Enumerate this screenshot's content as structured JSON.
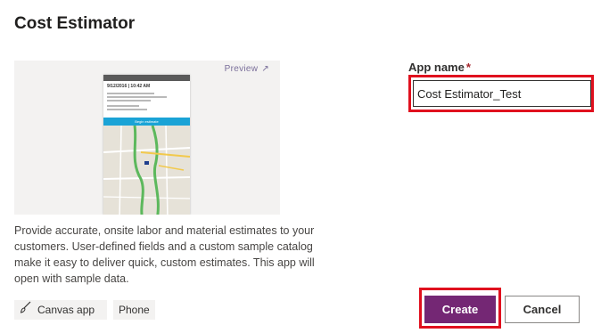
{
  "dialog": {
    "title": "Cost Estimator"
  },
  "preview": {
    "link_label": "Preview",
    "link_icon": "external-link-icon",
    "phone": {
      "date_text": "9/12/2016 | 10:42 AM",
      "button_text": "Begin estimate"
    }
  },
  "description": "Provide accurate, onsite labor and material estimates to your customers. User-defined fields and a custom sample catalog make it easy to deliver quick, custom estimates. This app will open with sample data.",
  "tags": [
    {
      "label": "Canvas app",
      "icon": "paintbrush-icon"
    },
    {
      "label": "Phone"
    }
  ],
  "form": {
    "app_name_label": "App name",
    "required_marker": "*",
    "app_name_value": "Cost Estimator_Test"
  },
  "actions": {
    "create_label": "Create",
    "cancel_label": "Cancel"
  },
  "colors": {
    "primary": "#742774",
    "highlight": "#e0101e",
    "required": "#a4262c"
  }
}
